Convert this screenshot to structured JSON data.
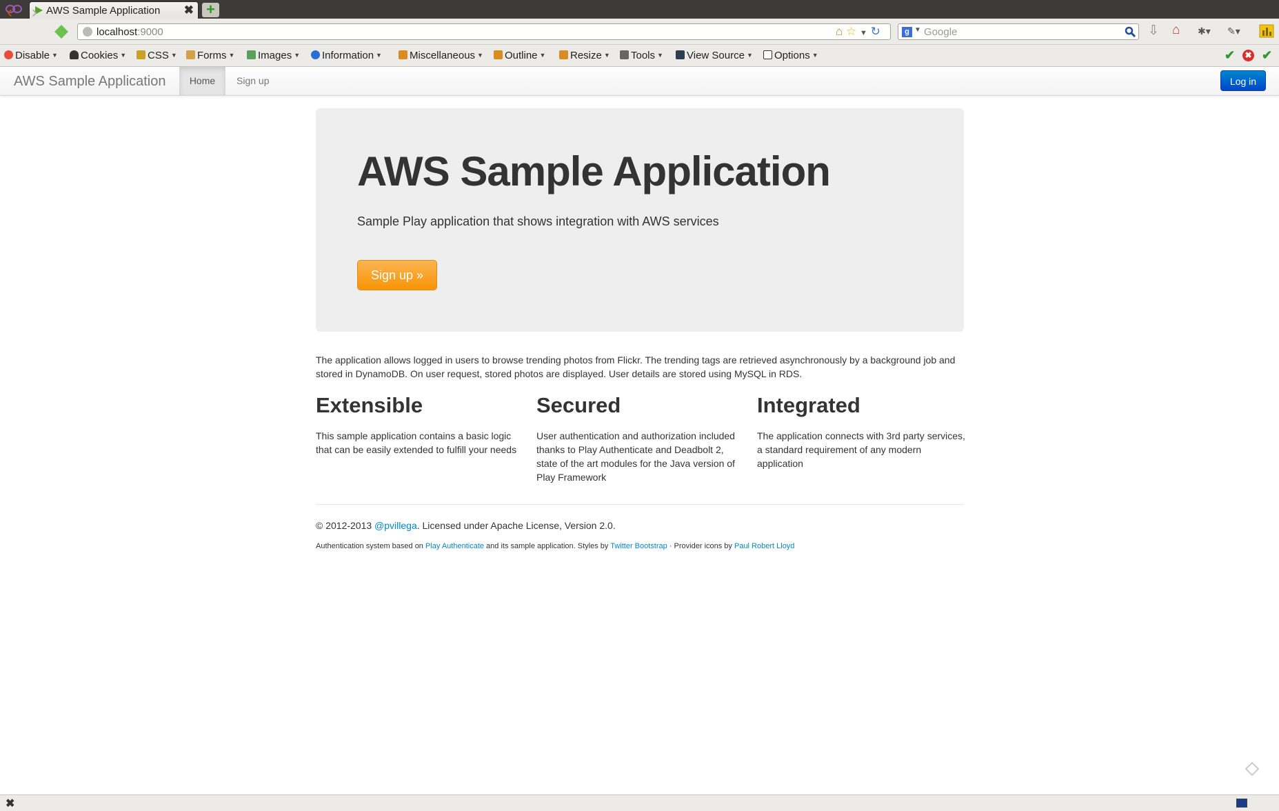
{
  "browser": {
    "tab_title": "AWS Sample Application",
    "tab_close": "✖",
    "new_tab": "+",
    "url_host": "localhost",
    "url_port": ":9000",
    "search_engine": "g",
    "search_placeholder": "Google"
  },
  "devtoolbar": {
    "items": [
      "Disable",
      "Cookies",
      "CSS",
      "Forms",
      "Images",
      "Information",
      "Miscellaneous",
      "Outline",
      "Resize",
      "Tools",
      "View Source",
      "Options"
    ]
  },
  "app": {
    "brand": "AWS Sample Application",
    "nav": {
      "home": "Home",
      "signup": "Sign up"
    },
    "login": "Log in",
    "hero": {
      "title": "AWS Sample Application",
      "subtitle": "Sample Play application that shows integration with AWS services",
      "button": "Sign up »"
    },
    "intro": "The application allows logged in users to browse trending photos from Flickr. The trending tags are retrieved asynchronously by a background job and stored in DynamoDB. On user request, stored photos are displayed. User details are stored using MySQL in RDS.",
    "columns": [
      {
        "title": "Extensible",
        "text": "This sample application contains a basic logic that can be easily extended to fulfill your needs"
      },
      {
        "title": "Secured",
        "text": "User authentication and authorization included thanks to Play Authenticate and Deadbolt 2, state of the art modules for the Java version of Play Framework"
      },
      {
        "title": "Integrated",
        "text": "The application connects with 3rd party services, a standard requirement of any modern application"
      }
    ],
    "footer": {
      "copy_prefix": "© 2012-2013 ",
      "copy_link": "@pvillega",
      "copy_suffix": ". Licensed under Apache License, Version 2.0.",
      "credits_1": "Authentication system based on ",
      "credits_link_1": "Play Authenticate",
      "credits_2": " and its sample application. Styles by ",
      "credits_link_2": "Twitter Bootstrap",
      "credits_3": " · Provider icons by ",
      "credits_link_3": "Paul Robert Lloyd"
    }
  },
  "statusbar": {
    "close": "✖"
  }
}
